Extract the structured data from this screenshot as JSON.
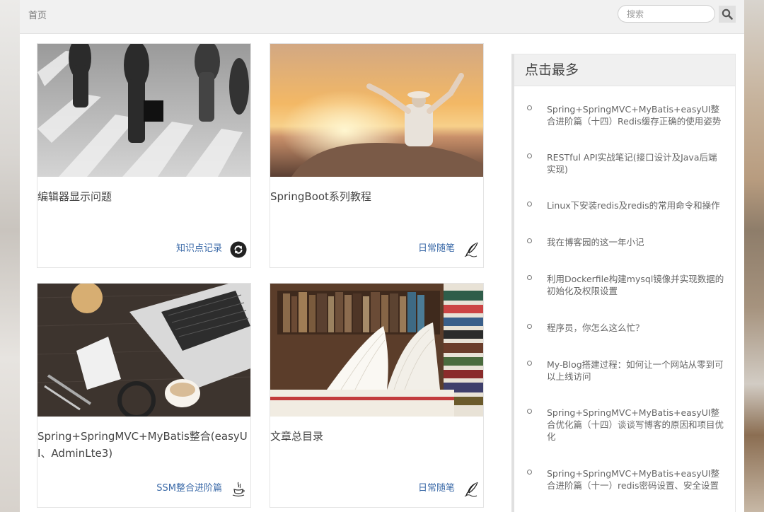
{
  "nav": {
    "home_label": "首页"
  },
  "search": {
    "placeholder": "搜索"
  },
  "cards": [
    {
      "title": "编辑器显示问题",
      "category": "知识点记录",
      "category_icon": "refresh-circle-icon"
    },
    {
      "title": "SpringBoot系列教程",
      "category": "日常随笔",
      "category_icon": "quill-pen-icon"
    },
    {
      "title": "Spring+SpringMVC+MyBatis整合(easyUI、AdminLte3)",
      "category": "SSM整合进阶篇",
      "category_icon": "java-coffee-icon"
    },
    {
      "title": "文章总目录",
      "category": "日常随笔",
      "category_icon": "quill-pen-icon"
    }
  ],
  "sidebar": {
    "title": "点击最多",
    "items": [
      "Spring+SpringMVC+MyBatis+easyUI整合进阶篇（十四）Redis缓存正确的使用姿势",
      "RESTful API实战笔记(接口设计及Java后端实现)",
      "Linux下安装redis及redis的常用命令和操作",
      "我在博客园的这一年小记",
      "利用Dockerfile构建mysql镜像并实现数据的初始化及权限设置",
      "程序员，你怎么这么忙？",
      "My-Blog搭建过程：如何让一个网站从零到可以上线访问",
      "Spring+SpringMVC+MyBatis+easyUI整合优化篇（十四）谈谈写博客的原因和项目优化",
      "Spring+SpringMVC+MyBatis+easyUI整合进阶篇（十一）redis密码设置、安全设置"
    ]
  }
}
